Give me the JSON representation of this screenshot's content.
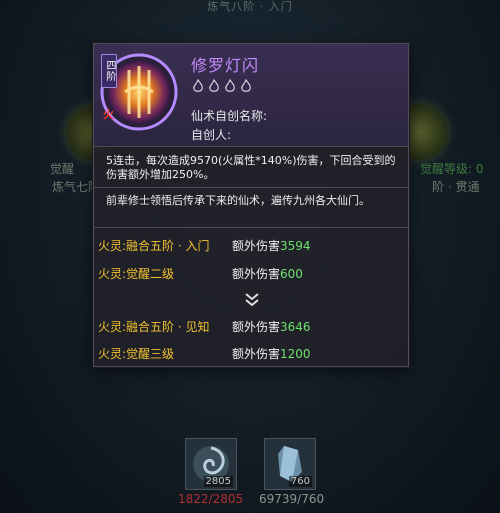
{
  "background": {
    "top_title": "炼气八阶 · 入门",
    "left_node_label_1": "觉醒",
    "left_node_label_2": "炼气七阶",
    "right_node_label_1": "觉醒等级: 0",
    "right_node_label_2": "阶 · 贯通",
    "slots": [
      {
        "icon": "swirl-item-icon",
        "count_badge": "2805",
        "count_text": "1822/2805"
      },
      {
        "icon": "crystal-item-icon",
        "count_badge": "760",
        "count_text": "69739/760"
      }
    ]
  },
  "tooltip": {
    "tier_badge": "四阶",
    "fire_mark": "火",
    "icon": "fire-spell-icon",
    "name": "修罗灯闪",
    "flame_count": 4,
    "custom_name_label": "仙术自创名称:",
    "creator_label": "自创人:",
    "description": "5连击，每次造成9570(火属性*140%)伤害，下回合受到的伤害额外增加250%。",
    "lore": "前辈修士领悟后传承下来的仙术，遍传九州各大仙门。",
    "upgrades_current": [
      {
        "requirement": "火灵:融合五阶 · 入门",
        "effect": "额外伤害",
        "value": "3594"
      },
      {
        "requirement": "火灵:觉醒二级",
        "effect": "额外伤害",
        "value": "600"
      }
    ],
    "upgrades_next": [
      {
        "requirement": "火灵:融合五阶 · 见知",
        "effect": "额外伤害",
        "value": "3646"
      },
      {
        "requirement": "火灵:觉醒三级",
        "effect": "额外伤害",
        "value": "1200"
      }
    ]
  },
  "colors": {
    "name_purple": "#c58bff",
    "requirement_gold": "#f2c230",
    "value_green": "#6ee06e",
    "count_red": "#b23030"
  }
}
